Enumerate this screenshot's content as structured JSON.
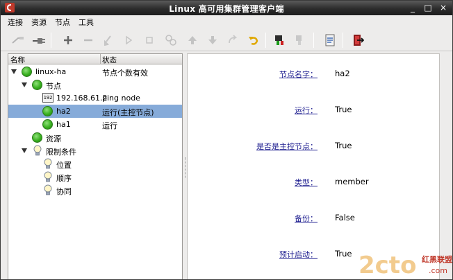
{
  "window": {
    "title": "Linux 高可用集群管理客户端",
    "minimize_glyph": "_",
    "maximize_glyph": "□",
    "close_glyph": "×"
  },
  "menu": [
    "连接",
    "资源",
    "节点",
    "工具"
  ],
  "toolbar": {
    "icons": [
      "connect-icon",
      "disconnect-icon",
      "add-icon",
      "remove-icon",
      "cleanup-icon",
      "start-icon",
      "stop-icon",
      "migrate-icon",
      "up-icon",
      "down-icon",
      "unmove-icon",
      "undo-icon",
      "node-up-icon",
      "node-down-icon",
      "view-log-icon",
      "exit-icon"
    ]
  },
  "tree": {
    "headers": {
      "name": "名称",
      "status": "状态"
    },
    "rows": [
      {
        "name": "linux-ha",
        "status": "节点个数有效"
      },
      {
        "name": "节点",
        "status": ""
      },
      {
        "name": "192.168.61.2",
        "status": "ping node",
        "host_icon_text": "192"
      },
      {
        "name": "ha2",
        "status": "运行(主控节点)"
      },
      {
        "name": "ha1",
        "status": "运行"
      },
      {
        "name": "资源",
        "status": ""
      },
      {
        "name": "限制条件",
        "status": ""
      },
      {
        "name": "位置",
        "status": ""
      },
      {
        "name": "顺序",
        "status": ""
      },
      {
        "name": "协同",
        "status": ""
      }
    ]
  },
  "properties": [
    {
      "label": "节点名字：",
      "value": "ha2"
    },
    {
      "label": "运行：",
      "value": "True"
    },
    {
      "label": "是否是主控节点：",
      "value": "True"
    },
    {
      "label": "类型：",
      "value": "member"
    },
    {
      "label": "备份：",
      "value": "False"
    },
    {
      "label": "预计启动：",
      "value": "True"
    }
  ],
  "watermark": {
    "logo": "2cto",
    "text": "红黑联盟",
    "domain": ".com"
  },
  "colors": {
    "selection": "#86abd9",
    "link": "#1d1d8f",
    "titlebar": "#2c2c2c"
  }
}
